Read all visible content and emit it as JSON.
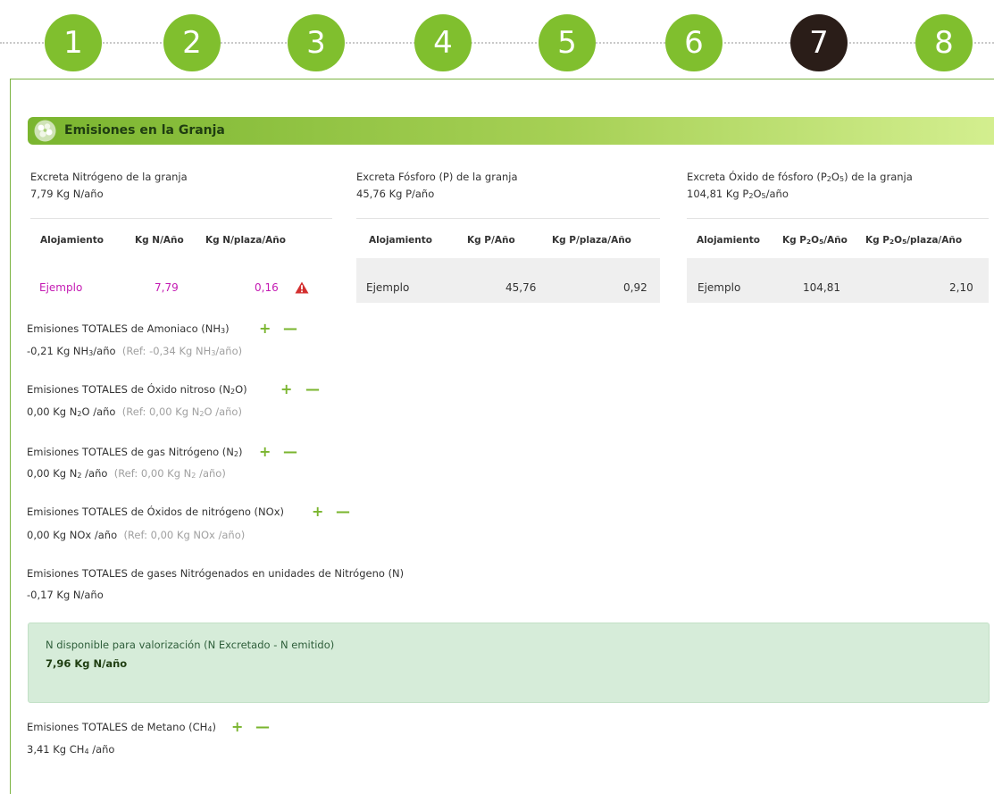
{
  "steps": [
    {
      "label": "1",
      "active": false
    },
    {
      "label": "2",
      "active": false
    },
    {
      "label": "3",
      "active": false
    },
    {
      "label": "4",
      "active": false
    },
    {
      "label": "5",
      "active": false
    },
    {
      "label": "6",
      "active": false
    },
    {
      "label": "7",
      "active": true
    },
    {
      "label": "8",
      "active": false
    }
  ],
  "colors": {
    "step": "#80bf2e",
    "step_active": "#2a1d18",
    "accent": "#7ab52f",
    "warning": "#d32f2f",
    "highlight": "#c41bb3"
  },
  "section": {
    "title": "Emisiones en la Granja",
    "icon": "leaf-cluster-icon"
  },
  "nitrogen": {
    "title": "Excreta Nitrógeno de la granja",
    "value": "7,79 Kg N/año",
    "headers": [
      "Alojamiento",
      "Kg N/Año",
      "Kg N/plaza/Año"
    ],
    "row": {
      "alojamiento": "Ejemplo",
      "total": "7,79",
      "per_place": "0,16",
      "warning": true
    }
  },
  "phosphorus": {
    "title": "Excreta Fósforo (P) de la granja",
    "value": "45,76 Kg P/año",
    "headers": [
      "Alojamiento",
      "Kg P/Año",
      "Kg P/plaza/Año"
    ],
    "row": {
      "alojamiento": "Ejemplo",
      "total": "45,76",
      "per_place": "0,92"
    }
  },
  "p2o5": {
    "title_pre": "Excreta Óxido de fósforo (P",
    "title_mid": "O",
    "title_post": ") de la granja",
    "value_pre": "104,81 Kg P",
    "value_mid": "O",
    "value_post": "/año",
    "headers": {
      "alojamiento": "Alojamiento",
      "total_pre": "Kg P",
      "total_mid": "O",
      "total_post": "/Año",
      "per_pre": "Kg P",
      "per_mid": "O",
      "per_post": "/plaza/Año"
    },
    "row": {
      "alojamiento": "Ejemplo",
      "total": "104,81",
      "per_place": "2,10"
    }
  },
  "emissions": {
    "nh3": {
      "title_pre": "Emisiones TOTALES de Amoniaco (NH",
      "sub": "3",
      "title_post": ")",
      "val_pre": "-0,21 Kg NH",
      "val_post": "/año",
      "ref_pre": "(Ref: -0,34 Kg NH",
      "ref_post": "/año)"
    },
    "n2o": {
      "title_pre": "Emisiones TOTALES de Óxido nitroso (N",
      "sub": "2",
      "title_post": "O)",
      "val_pre": "0,00 Kg N",
      "val_post": "O /año",
      "ref_pre": "(Ref: 0,00 Kg N",
      "ref_post": "O /año)"
    },
    "n2": {
      "title_pre": "Emisiones TOTALES de gas Nitrógeno (N",
      "sub": "2",
      "title_post": ")",
      "val_pre": "0,00 Kg N",
      "val_post": " /año",
      "ref_pre": "(Ref: 0,00 Kg N",
      "ref_post": " /año)"
    },
    "nox": {
      "title": "Emisiones TOTALES de Óxidos de nitrógeno (NOx)",
      "val": "0,00 Kg NOx /año",
      "ref": "(Ref: 0,00 Kg NOx /año)"
    },
    "n_total": {
      "title": "Emisiones TOTALES de gases Nitrógenados en unidades de Nitrógeno (N)",
      "val": "-0,17 Kg N/año"
    },
    "ch4": {
      "title_pre": "Emisiones TOTALES de Metano (CH",
      "sub": "4",
      "title_post": ")",
      "val_pre": "3,41 Kg CH",
      "val_post": " /año"
    }
  },
  "available": {
    "title": "N disponible para valorización (N Excretado - N emitido)",
    "value": "7,96 Kg N/año"
  },
  "controls": {
    "plus": "+",
    "minus": "—"
  }
}
